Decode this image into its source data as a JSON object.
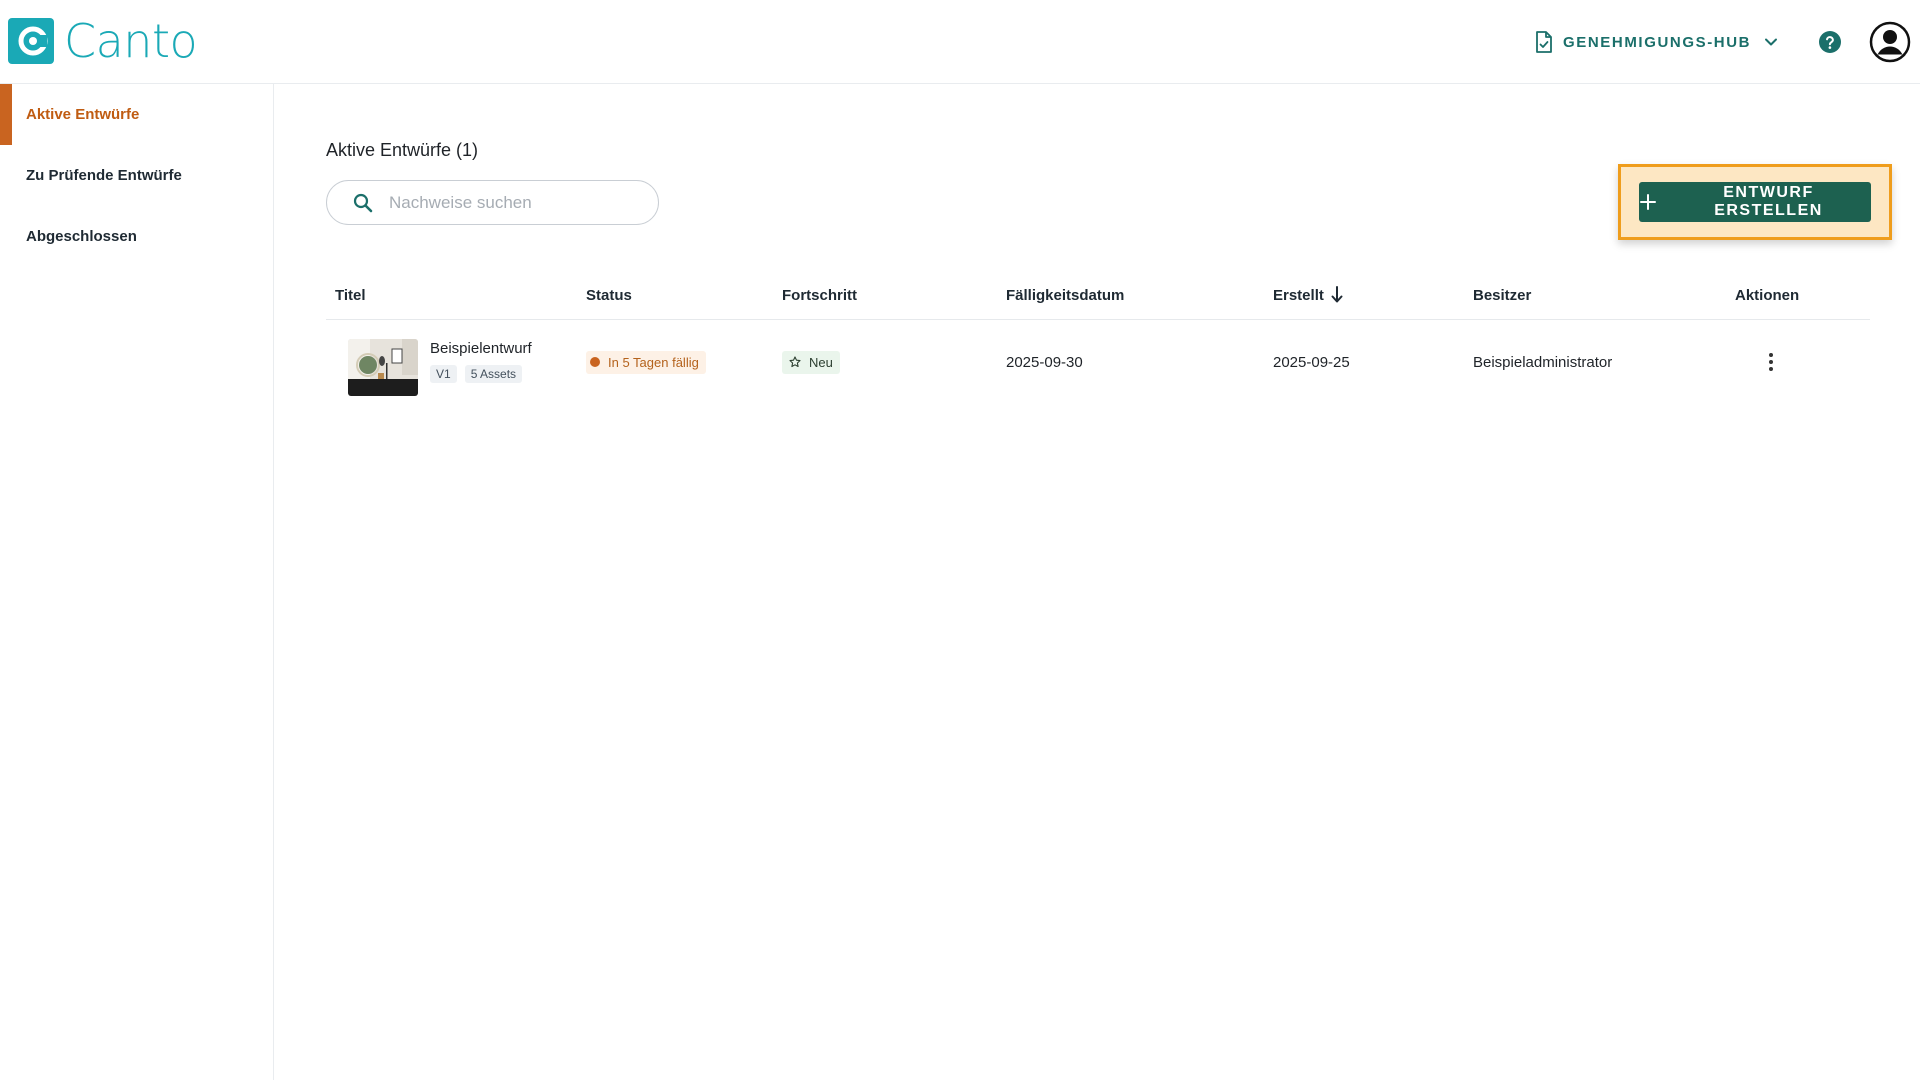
{
  "brand": {
    "name": "Canto",
    "color": "#1aa9b6"
  },
  "header": {
    "hub_label": "GENEHMIGUNGS-HUB",
    "hub_icon": "document-check-icon",
    "help_icon": "help-icon",
    "profile_icon": "user-avatar-icon"
  },
  "sidebar": {
    "items": [
      {
        "label": "Aktive Entwürfe",
        "active": true
      },
      {
        "label": "Zu Prüfende Entwürfe",
        "active": false
      },
      {
        "label": "Abgeschlossen",
        "active": false
      }
    ],
    "accent": "#c96420"
  },
  "main": {
    "title": "Aktive Entwürfe (1)",
    "search": {
      "placeholder": "Nachweise suchen",
      "value": ""
    },
    "create_button": "ENTWURF ERSTELLEN"
  },
  "table": {
    "columns": [
      "Titel",
      "Status",
      "Fortschritt",
      "Fälligkeitsdatum",
      "Erstellt",
      "Besitzer",
      "Aktionen"
    ],
    "sort_column": "Erstellt",
    "sort_direction": "descending",
    "rows": [
      {
        "title": "Beispielentwurf",
        "version": "V1",
        "assets": "5 Assets",
        "status": "In 5 Tagen fällig",
        "progress": "Neu",
        "due": "2025-09-30",
        "created": "2025-09-25",
        "owner": "Beispieladministrator"
      }
    ]
  },
  "colors": {
    "primary_button": "#1d6150",
    "highlight_border": "#ef9d1c",
    "status_warning": "#c96420",
    "progress_new_bg": "#eaf5ec"
  }
}
